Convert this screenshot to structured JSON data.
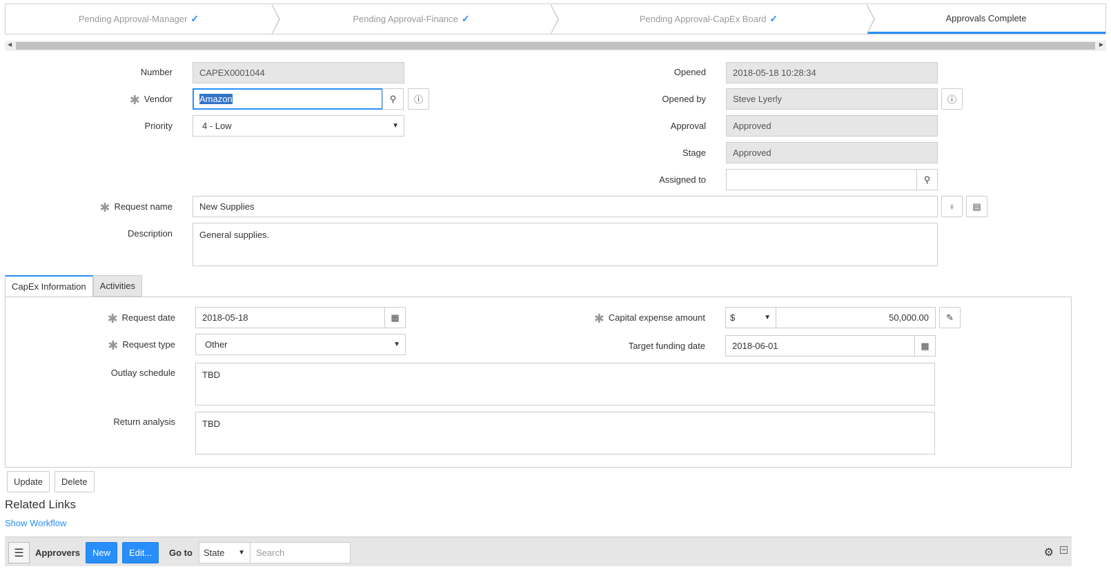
{
  "flow": {
    "steps": [
      {
        "label": "Pending Approval-Manager",
        "done": true
      },
      {
        "label": "Pending Approval-Finance",
        "done": true
      },
      {
        "label": "Pending Approval-CapEx Board",
        "done": true
      },
      {
        "label": "Approvals Complete",
        "done": false
      }
    ]
  },
  "form": {
    "number_label": "Number",
    "number_value": "CAPEX0001044",
    "vendor_label": "Vendor",
    "vendor_value": "Amazon",
    "priority_label": "Priority",
    "priority_value": "4 - Low",
    "opened_label": "Opened",
    "opened_value": "2018-05-18 10:28:34",
    "opened_by_label": "Opened by",
    "opened_by_value": "Steve Lyerly",
    "approval_label": "Approval",
    "approval_value": "Approved",
    "stage_label": "Stage",
    "stage_value": "Approved",
    "assigned_label": "Assigned to",
    "assigned_value": "",
    "request_name_label": "Request name",
    "request_name_value": "New Supplies",
    "description_label": "Description",
    "description_value": "General supplies."
  },
  "tabs": {
    "capex": "CapEx Information",
    "activities": "Activities"
  },
  "capex": {
    "request_date_label": "Request date",
    "request_date_value": "2018-05-18",
    "request_type_label": "Request type",
    "request_type_value": "Other",
    "outlay_label": "Outlay schedule",
    "outlay_value": "TBD",
    "return_label": "Return analysis",
    "return_value": "TBD",
    "amount_label": "Capital expense amount",
    "currency": "$",
    "amount_value": "50,000.00",
    "target_label": "Target funding date",
    "target_value": "2018-06-01"
  },
  "actions": {
    "update": "Update",
    "delete": "Delete"
  },
  "related": {
    "title": "Related Links",
    "show_workflow": "Show Workflow"
  },
  "listbar": {
    "title": "Approvers",
    "new": "New",
    "edit": "Edit...",
    "goto": "Go to",
    "state": "State",
    "search_placeholder": "Search"
  },
  "colors": {
    "accent": "#278efc",
    "readonly_bg": "#e6e6e6"
  }
}
